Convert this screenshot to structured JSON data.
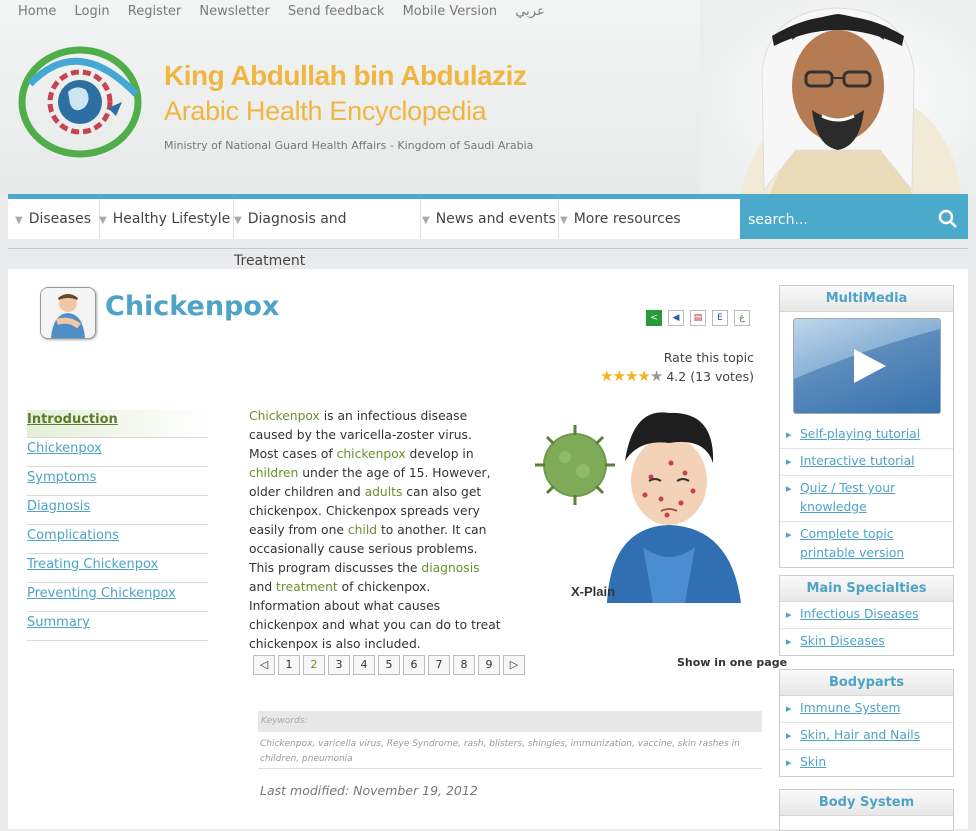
{
  "toplinks": [
    "Home",
    "Login",
    "Register",
    "Newsletter",
    "Send feedback",
    "Mobile Version",
    "عربي"
  ],
  "brand": {
    "line1": "King Abdullah bin Abdulaziz",
    "line2": "Arabic Health Encyclopedia",
    "line3": "Ministry of National Guard Health Affairs - Kingdom of Saudi Arabia"
  },
  "nav": [
    "Diseases",
    "Healthy Lifestyle",
    "Diagnosis and Treatment",
    "News and events",
    "More resources"
  ],
  "search": {
    "placeholder": "search..."
  },
  "page": {
    "title": "Chickenpox",
    "rate_label": "Rate this topic",
    "rating": "4.2",
    "votes": "(13 votes)",
    "rating_value": 4.2,
    "tools": [
      "share-icon",
      "speaker-icon",
      "pdf-icon",
      "E",
      "ع"
    ]
  },
  "toc": [
    "Introduction",
    "Chickenpox",
    "Symptoms",
    "Diagnosis",
    "Complications",
    "Treating Chickenpox",
    "Preventing Chickenpox",
    "Summary"
  ],
  "article": {
    "s1": "Chickenpox",
    "t1": " is an infectious disease caused by the varicella-zoster virus. Most cases of ",
    "s2": "chickenpox",
    "t2": " develop in ",
    "s3": "children",
    "t3": " under the age of 15. However, older children and ",
    "s4": "adults",
    "t4": " can also get chickenpox. Chickenpox spreads very easily from one ",
    "s5": "child",
    "t5": " to another. It can occasionally cause serious problems. This program discusses the ",
    "s6": "diagnosis",
    "t6": " and ",
    "s7": "treatment",
    "t7": " of chickenpox. Information about what causes chickenpox and what you can do to treat chickenpox is also included."
  },
  "illustration_caption": "X-Plain",
  "pager": {
    "pages": [
      "1",
      "2",
      "3",
      "4",
      "5",
      "6",
      "7",
      "8",
      "9"
    ],
    "current": "2",
    "show_one": "Show in one page"
  },
  "keywords": {
    "label": "Keywords:",
    "text": "Chickenpox, varicella virus, Reye Syndrome, rash, blisters, shingles, immunization, vaccine, skin rashes in children, pneumonia"
  },
  "modified": "Last modified: November 19, 2012",
  "multimedia": {
    "title": "MultiMedia",
    "items": [
      "Self-playing tutorial",
      "Interactive tutorial",
      "Quiz / Test your knowledge",
      "Complete topic printable version"
    ]
  },
  "specialties": {
    "title": "Main Specialties",
    "items": [
      "Infectious Diseases",
      "Skin Diseases"
    ]
  },
  "bodyparts": {
    "title": "Bodyparts",
    "items": [
      "Immune System",
      "Skin, Hair and Nails",
      "Skin"
    ]
  },
  "bodysystem": {
    "title": "Body System"
  },
  "colors": {
    "accent": "#4ea3c6",
    "brand": "#f1b642",
    "green": "#6b8e2e",
    "nav_bar": "#4baacb"
  }
}
